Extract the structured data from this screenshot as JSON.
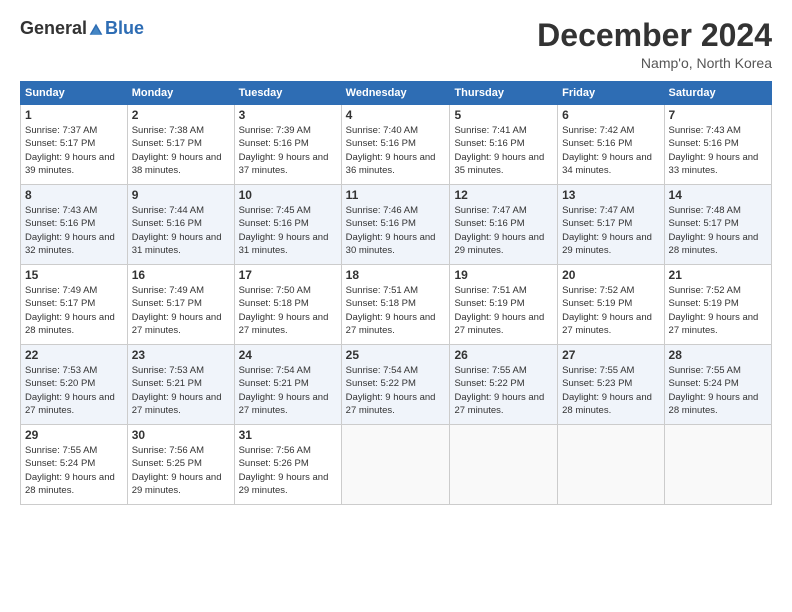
{
  "logo": {
    "general": "General",
    "blue": "Blue"
  },
  "title": "December 2024",
  "location": "Namp'o, North Korea",
  "days_header": [
    "Sunday",
    "Monday",
    "Tuesday",
    "Wednesday",
    "Thursday",
    "Friday",
    "Saturday"
  ],
  "weeks": [
    [
      {
        "day": "1",
        "sunrise": "7:37 AM",
        "sunset": "5:17 PM",
        "daylight": "9 hours and 39 minutes."
      },
      {
        "day": "2",
        "sunrise": "7:38 AM",
        "sunset": "5:17 PM",
        "daylight": "9 hours and 38 minutes."
      },
      {
        "day": "3",
        "sunrise": "7:39 AM",
        "sunset": "5:16 PM",
        "daylight": "9 hours and 37 minutes."
      },
      {
        "day": "4",
        "sunrise": "7:40 AM",
        "sunset": "5:16 PM",
        "daylight": "9 hours and 36 minutes."
      },
      {
        "day": "5",
        "sunrise": "7:41 AM",
        "sunset": "5:16 PM",
        "daylight": "9 hours and 35 minutes."
      },
      {
        "day": "6",
        "sunrise": "7:42 AM",
        "sunset": "5:16 PM",
        "daylight": "9 hours and 34 minutes."
      },
      {
        "day": "7",
        "sunrise": "7:43 AM",
        "sunset": "5:16 PM",
        "daylight": "9 hours and 33 minutes."
      }
    ],
    [
      {
        "day": "8",
        "sunrise": "7:43 AM",
        "sunset": "5:16 PM",
        "daylight": "9 hours and 32 minutes."
      },
      {
        "day": "9",
        "sunrise": "7:44 AM",
        "sunset": "5:16 PM",
        "daylight": "9 hours and 31 minutes."
      },
      {
        "day": "10",
        "sunrise": "7:45 AM",
        "sunset": "5:16 PM",
        "daylight": "9 hours and 31 minutes."
      },
      {
        "day": "11",
        "sunrise": "7:46 AM",
        "sunset": "5:16 PM",
        "daylight": "9 hours and 30 minutes."
      },
      {
        "day": "12",
        "sunrise": "7:47 AM",
        "sunset": "5:16 PM",
        "daylight": "9 hours and 29 minutes."
      },
      {
        "day": "13",
        "sunrise": "7:47 AM",
        "sunset": "5:17 PM",
        "daylight": "9 hours and 29 minutes."
      },
      {
        "day": "14",
        "sunrise": "7:48 AM",
        "sunset": "5:17 PM",
        "daylight": "9 hours and 28 minutes."
      }
    ],
    [
      {
        "day": "15",
        "sunrise": "7:49 AM",
        "sunset": "5:17 PM",
        "daylight": "9 hours and 28 minutes."
      },
      {
        "day": "16",
        "sunrise": "7:49 AM",
        "sunset": "5:17 PM",
        "daylight": "9 hours and 27 minutes."
      },
      {
        "day": "17",
        "sunrise": "7:50 AM",
        "sunset": "5:18 PM",
        "daylight": "9 hours and 27 minutes."
      },
      {
        "day": "18",
        "sunrise": "7:51 AM",
        "sunset": "5:18 PM",
        "daylight": "9 hours and 27 minutes."
      },
      {
        "day": "19",
        "sunrise": "7:51 AM",
        "sunset": "5:19 PM",
        "daylight": "9 hours and 27 minutes."
      },
      {
        "day": "20",
        "sunrise": "7:52 AM",
        "sunset": "5:19 PM",
        "daylight": "9 hours and 27 minutes."
      },
      {
        "day": "21",
        "sunrise": "7:52 AM",
        "sunset": "5:19 PM",
        "daylight": "9 hours and 27 minutes."
      }
    ],
    [
      {
        "day": "22",
        "sunrise": "7:53 AM",
        "sunset": "5:20 PM",
        "daylight": "9 hours and 27 minutes."
      },
      {
        "day": "23",
        "sunrise": "7:53 AM",
        "sunset": "5:21 PM",
        "daylight": "9 hours and 27 minutes."
      },
      {
        "day": "24",
        "sunrise": "7:54 AM",
        "sunset": "5:21 PM",
        "daylight": "9 hours and 27 minutes."
      },
      {
        "day": "25",
        "sunrise": "7:54 AM",
        "sunset": "5:22 PM",
        "daylight": "9 hours and 27 minutes."
      },
      {
        "day": "26",
        "sunrise": "7:55 AM",
        "sunset": "5:22 PM",
        "daylight": "9 hours and 27 minutes."
      },
      {
        "day": "27",
        "sunrise": "7:55 AM",
        "sunset": "5:23 PM",
        "daylight": "9 hours and 28 minutes."
      },
      {
        "day": "28",
        "sunrise": "7:55 AM",
        "sunset": "5:24 PM",
        "daylight": "9 hours and 28 minutes."
      }
    ],
    [
      {
        "day": "29",
        "sunrise": "7:55 AM",
        "sunset": "5:24 PM",
        "daylight": "9 hours and 28 minutes."
      },
      {
        "day": "30",
        "sunrise": "7:56 AM",
        "sunset": "5:25 PM",
        "daylight": "9 hours and 29 minutes."
      },
      {
        "day": "31",
        "sunrise": "7:56 AM",
        "sunset": "5:26 PM",
        "daylight": "9 hours and 29 minutes."
      },
      null,
      null,
      null,
      null
    ]
  ]
}
